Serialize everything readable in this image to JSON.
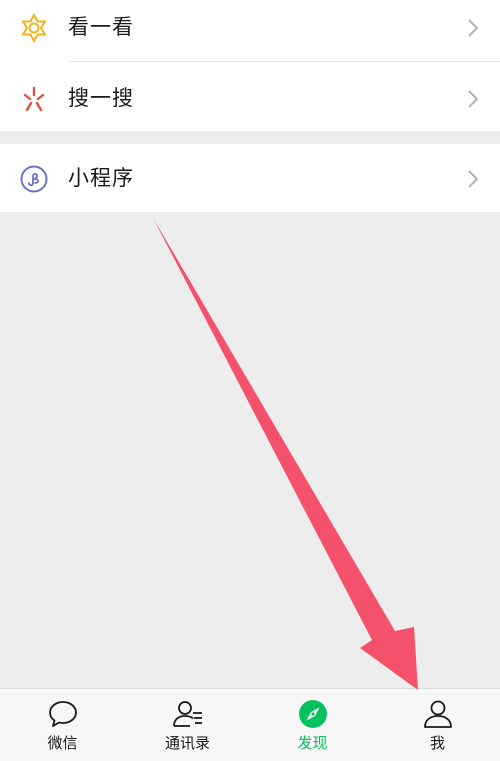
{
  "menu": {
    "items": [
      {
        "label": "看一看",
        "icon": "look-icon"
      },
      {
        "label": "搜一搜",
        "icon": "search-sparkle-icon"
      },
      {
        "label": "小程序",
        "icon": "mini-program-icon"
      }
    ]
  },
  "tabbar": {
    "tabs": [
      {
        "label": "微信",
        "icon": "chat-bubble-icon",
        "active": false
      },
      {
        "label": "通讯录",
        "icon": "contacts-icon",
        "active": false
      },
      {
        "label": "发现",
        "icon": "compass-icon",
        "active": true
      },
      {
        "label": "我",
        "icon": "person-icon",
        "active": false
      }
    ]
  },
  "colors": {
    "active_tab": "#07c160",
    "arrow": "#f4516c",
    "background": "#ededed",
    "look_icon": "#f0b51e",
    "search_icon": "#e0523e",
    "mini_program_icon": "#6b73c8"
  }
}
